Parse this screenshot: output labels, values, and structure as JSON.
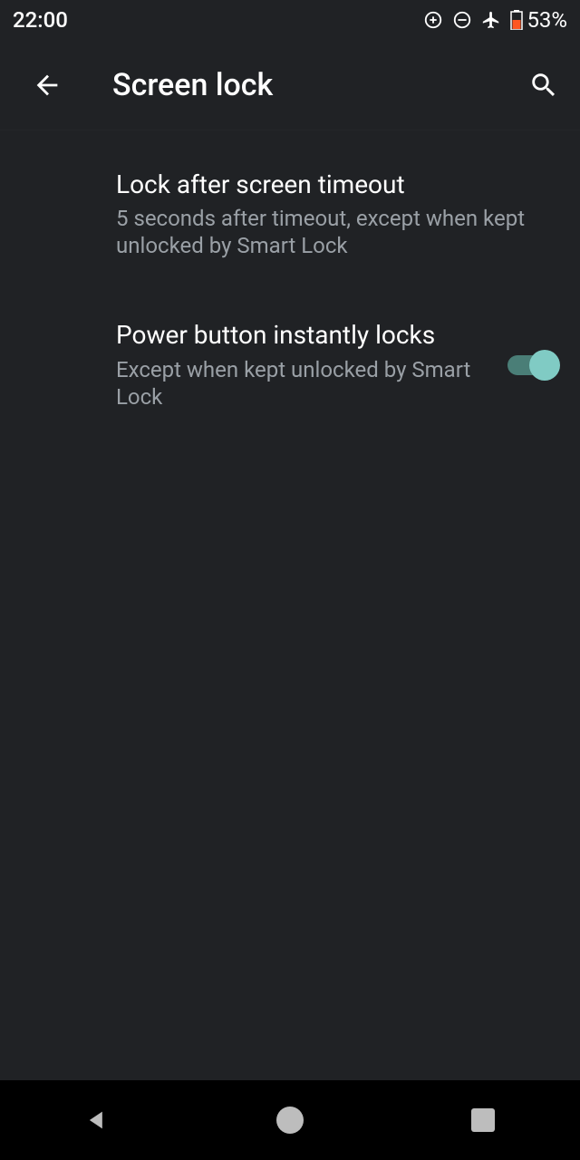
{
  "status_bar": {
    "time": "22:00",
    "battery_percent": "53%"
  },
  "app_bar": {
    "title": "Screen lock"
  },
  "settings": {
    "lock_after": {
      "title": "Lock after screen timeout",
      "subtitle": "5 seconds after timeout, except when kept unlocked by Smart Lock"
    },
    "power_button": {
      "title": "Power button instantly locks",
      "subtitle": "Except when kept unlocked by Smart Lock",
      "enabled": true
    }
  },
  "colors": {
    "accent": "#80cbc4",
    "background": "#202225",
    "nav_bg": "#000000",
    "text_secondary": "#9aa0a6"
  }
}
